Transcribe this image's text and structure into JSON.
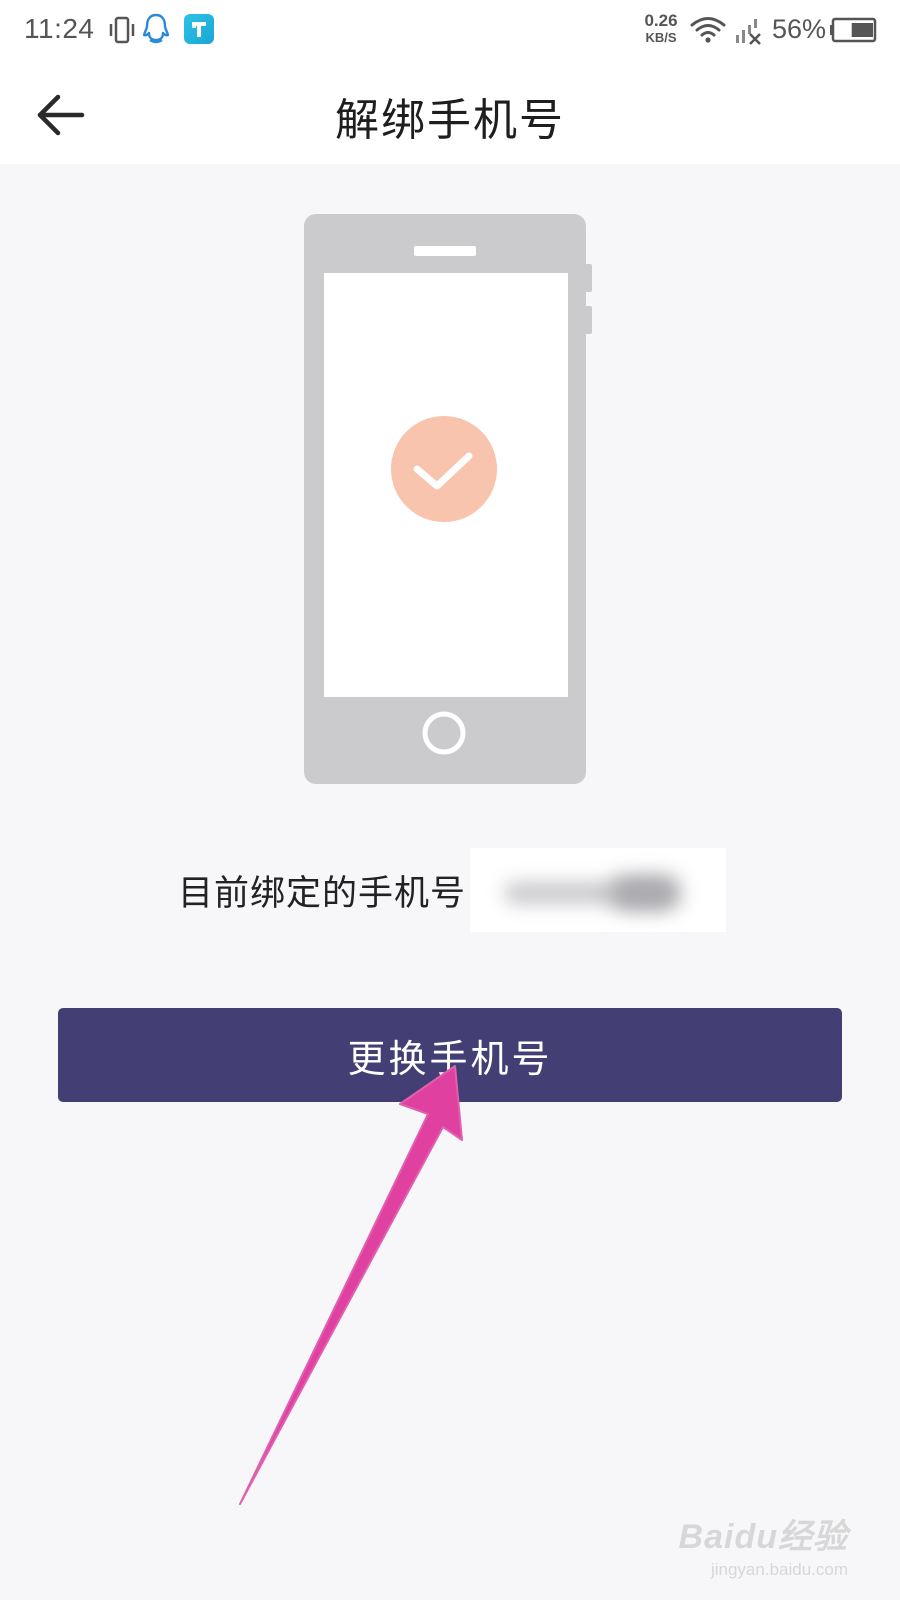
{
  "status_bar": {
    "time": "11:24",
    "net_speed_value": "0.26",
    "net_speed_unit": "KB/S",
    "battery_percent": "56%",
    "battery_level": 0.56,
    "icons": [
      "vibrate-icon",
      "qq-icon",
      "app-icon",
      "wifi-icon",
      "signal-no-service-icon",
      "battery-icon"
    ]
  },
  "header": {
    "back_icon": "arrow-left-icon",
    "title": "解绑手机号"
  },
  "main": {
    "illustration_icon": "phone-check-icon",
    "bound_label": "目前绑定的手机号",
    "change_button_label": "更换手机号"
  },
  "colors": {
    "button_bg": "#433e74",
    "check_circle": "#f8c4ad",
    "phone_body": "#cbcbcd",
    "annotation_arrow": "#e040a0"
  },
  "watermark": {
    "brand": "Baidu经验",
    "url": "jingyan.baidu.com"
  }
}
